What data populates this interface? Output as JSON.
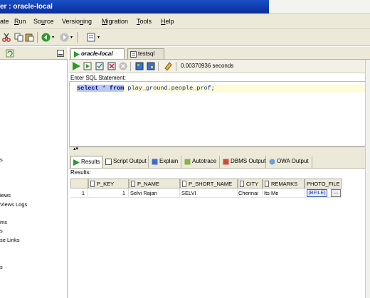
{
  "window": {
    "title": "er : oracle-local"
  },
  "menu": {
    "items": [
      {
        "pre": "",
        "ul": "",
        "post": "ate"
      },
      {
        "pre": "",
        "ul": "R",
        "post": "un"
      },
      {
        "pre": "So",
        "ul": "u",
        "post": "rce"
      },
      {
        "pre": "Versio",
        "ul": "n",
        "post": "ing"
      },
      {
        "pre": "",
        "ul": "M",
        "post": "igration"
      },
      {
        "pre": "",
        "ul": "T",
        "post": "ools"
      },
      {
        "pre": "",
        "ul": "H",
        "post": "elp"
      }
    ]
  },
  "navigator": {
    "items": [
      "s",
      "iews",
      "Views Logs",
      "ms",
      "s",
      "se Links",
      "s"
    ]
  },
  "editor": {
    "tabs": [
      {
        "label": "oracle-local",
        "active": true
      },
      {
        "label": "testsql",
        "active": false
      }
    ],
    "elapsed": "0.00370936 seconds",
    "sql_label": "Enter SQL Statement:",
    "sql": {
      "kw1": "select",
      "star": " * ",
      "kw2": "from",
      "target": " play_ground.people_prof;"
    }
  },
  "results": {
    "tabs": [
      {
        "label": "Results",
        "active": true
      },
      {
        "label": "Script Output",
        "active": false
      },
      {
        "label": "Explain",
        "active": false
      },
      {
        "label": "Autotrace",
        "active": false
      },
      {
        "label": "DBMS Output",
        "active": false
      },
      {
        "label": "OWA Output",
        "active": false
      }
    ],
    "label": "Results:",
    "columns": [
      "P_KEY",
      "P_NAME",
      "P_SHORT_NAME",
      "CITY",
      "REMARKS",
      "PHOTO_FILE"
    ],
    "rows": [
      {
        "num": "1",
        "p_key": "1",
        "p_name": "Selvi Rajan",
        "p_short_name": "SELVI",
        "city": "Chennai",
        "remarks": "Its Me",
        "photo_file": "(BFILE)"
      }
    ],
    "cell_button": "..."
  },
  "colors": {
    "titlebar": "#0a2e9c",
    "chrome": "#ece9d8",
    "sql_highlight": "#fdfbd8",
    "run_green": "#2a9a2a"
  },
  "icons": [
    "cut-icon",
    "copy-icon",
    "paste-icon",
    "back-icon",
    "forward-icon",
    "run-icon",
    "run-script-icon",
    "commit-icon",
    "rollback-icon",
    "cancel-icon",
    "eraser-icon"
  ]
}
